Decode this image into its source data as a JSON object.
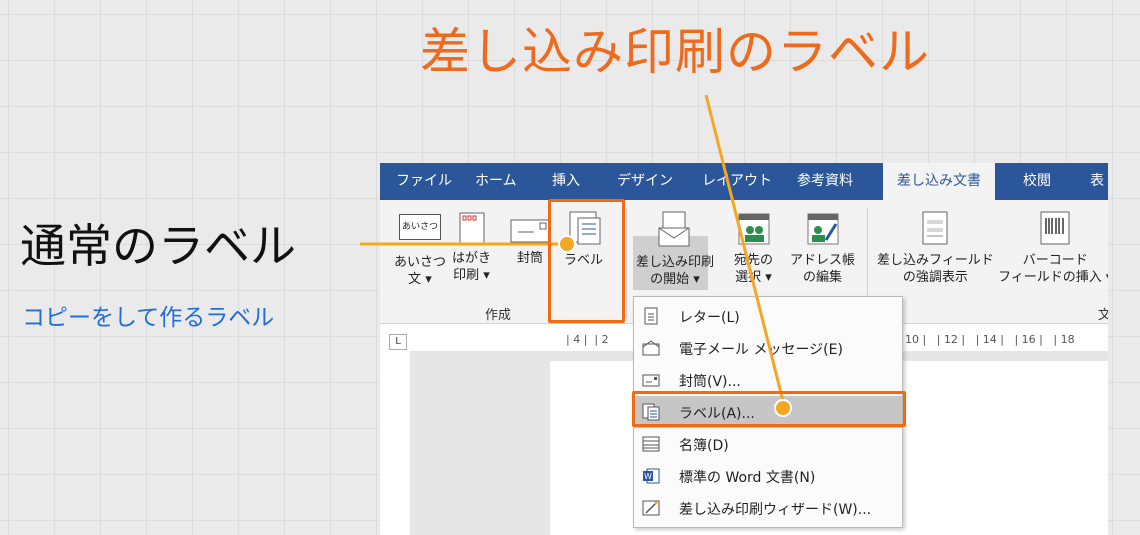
{
  "title": "差し込み印刷のラベル",
  "left_title": "通常のラベル",
  "left_subtitle": "コピーをして作るラベル",
  "tabs": [
    "ファイル",
    "ホーム",
    "挿入",
    "デザイン",
    "レイアウト",
    "参考資料",
    "差し込み文書",
    "校閲",
    "表"
  ],
  "ribbon": {
    "greeting": {
      "icon_text": "あいさつ",
      "line1": "あいさつ",
      "line2": "文 ▾"
    },
    "postcard": {
      "line1": "はがき",
      "line2": "印刷 ▾"
    },
    "envelope": {
      "label": "封筒"
    },
    "label": {
      "label": "ラベル"
    },
    "start_merge": {
      "line1": "差し込み印刷",
      "line2": "の開始 ▾"
    },
    "recipients": {
      "line1": "宛先の",
      "line2": "選択 ▾"
    },
    "address_book": {
      "line1": "アドレス帳",
      "line2": "の編集"
    },
    "highlight": {
      "line1": "差し込みフィールド",
      "line2": "の強調表示"
    },
    "barcode": {
      "line1": "バーコード",
      "line2": "フィールドの挿入 ▾"
    },
    "group_create": "作成",
    "group_partial": "文"
  },
  "ruler_top": "| 4 |  | 2",
  "ruler_top_right": "10 |   | 12 |   | 14 |   | 16 |   | 18",
  "corner": "L",
  "menu": [
    {
      "icon": "document-icon",
      "label": "レター(L)"
    },
    {
      "icon": "email-icon",
      "label": "電子メール メッセージ(E)"
    },
    {
      "icon": "envelope-icon",
      "label": "封筒(V)..."
    },
    {
      "icon": "label-icon",
      "label": "ラベル(A)..."
    },
    {
      "icon": "list-icon",
      "label": "名簿(D)"
    },
    {
      "icon": "word-icon",
      "label": "標準の Word 文書(N)"
    },
    {
      "icon": "wizard-icon",
      "label": "差し込み印刷ウィザード(W)..."
    }
  ],
  "colors": {
    "accent": "#ee6a1c",
    "word_blue": "#2b579a",
    "highlight": "#f26a13",
    "dot": "#f5a623",
    "subtitle": "#1f6fd6"
  }
}
